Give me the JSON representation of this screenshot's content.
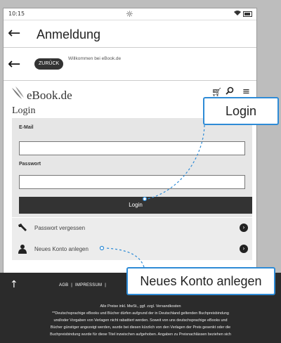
{
  "status_bar": {
    "time": "10:15",
    "brightness_icon": "sun-icon",
    "wifi_icon": "wifi-icon",
    "battery_icon": "battery-icon"
  },
  "title_bar": {
    "back_icon": "arrow-left-icon",
    "title": "Anmeldung"
  },
  "app_bar": {
    "back_icon": "arrow-left-icon",
    "back_button": "ZURÜCK",
    "welcome": "Willkommen bei eBook.de"
  },
  "header": {
    "logo": "eBook.de",
    "cart_icon": "cart-icon",
    "search_icon": "search-icon",
    "menu_icon": "menu-icon"
  },
  "login": {
    "heading": "Login",
    "email_label": "E-Mail",
    "email_value": "",
    "password_label": "Passwort",
    "password_value": "",
    "submit_label": "Login"
  },
  "links": {
    "forgot_password": "Passwort vergessen",
    "new_account": "Neues Konto anlegen"
  },
  "footer": {
    "top_icon": "arrow-up-icon",
    "links": [
      "AGB",
      "|",
      "IMPRESSUM",
      "|"
    ],
    "text_lines": [
      "Alle Preise inkl. MwSt., ggf. zzgl. Versandkosten",
      "**Deutschsprachige eBooks und Bücher dürfen aufgrund der in Deutschland geltenden Buchpreisbindung",
      "und/oder Vorgaben von Verlagen nicht rabattiert werden. Soweit von uns deutschsprachige eBooks und",
      "Bücher günstiger angezeigt werden, wurde bei diesen kürzlich von den Verlagen der Preis gesenkt oder die",
      "Buchpreisbindung wurde für diese Titel inzwischen aufgehoben. Angaben zu Preisnachlässen beziehen sich"
    ]
  },
  "callouts": {
    "login": "Login",
    "new_account": "Neues Konto anlegen"
  },
  "colors": {
    "accent": "#2e8bd6",
    "dark": "#2b2b2b",
    "form_bg": "#e6e6e6"
  }
}
